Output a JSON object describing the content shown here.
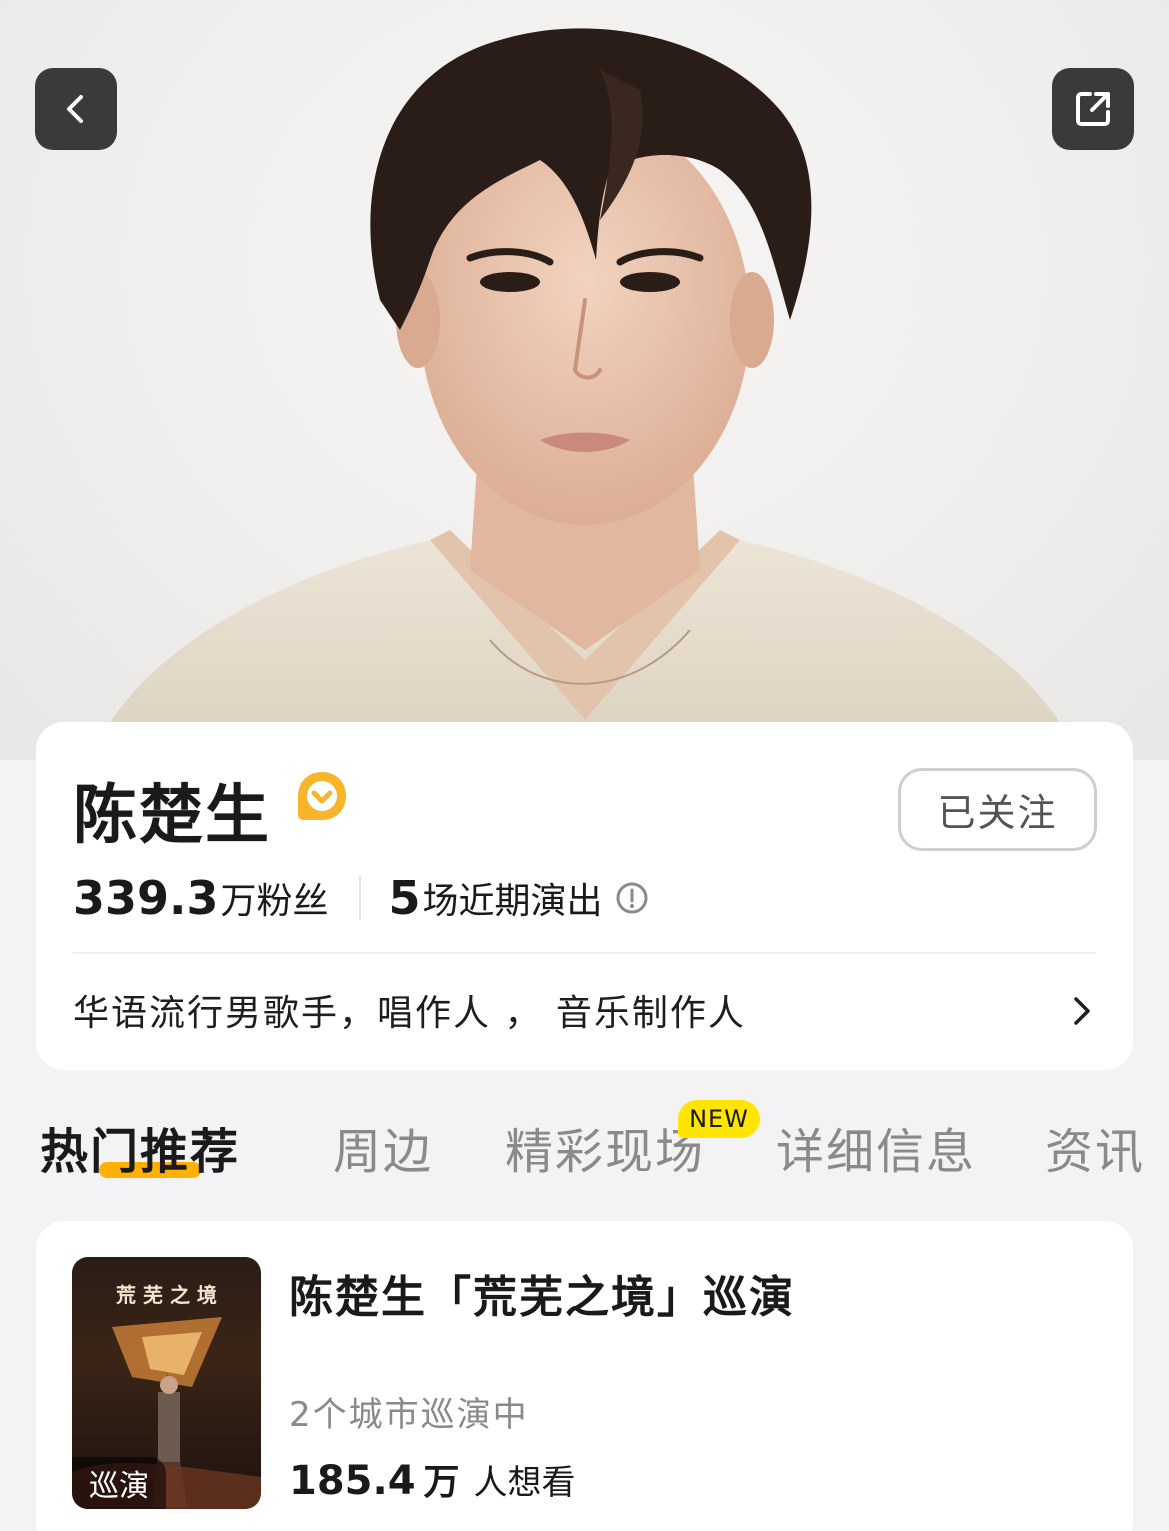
{
  "artist": {
    "name": "陈楚生",
    "follow_label": "已关注",
    "fans_count": "339.3",
    "fans_unit": "万粉丝",
    "shows_count": "5",
    "shows_label": "场近期演出",
    "bio": "华语流行男歌手，唱作人 ， 音乐制作人"
  },
  "tabs": [
    {
      "label": "热门推荐",
      "active": true
    },
    {
      "label": "周边",
      "active": false
    },
    {
      "label": "精彩现场",
      "active": false,
      "badge": "NEW"
    },
    {
      "label": "详细信息",
      "active": false
    },
    {
      "label": "资讯",
      "active": false
    }
  ],
  "event": {
    "title": "陈楚生「荒芜之境」巡演",
    "poster_tag": "巡演",
    "poster_text": "荒 芜 之 境",
    "subtitle": "2个城市巡演中",
    "want_count": "185.4",
    "want_unit": "万",
    "want_label": "人想看"
  },
  "colors": {
    "accent": "#ffb000",
    "badge": "#ffe500",
    "verified": "#f7b52b"
  },
  "icons": {
    "back": "chevron-left-icon",
    "share": "share-icon",
    "verified": "verified-badge-icon",
    "info": "info-icon",
    "bio_more": "chevron-right-icon"
  }
}
